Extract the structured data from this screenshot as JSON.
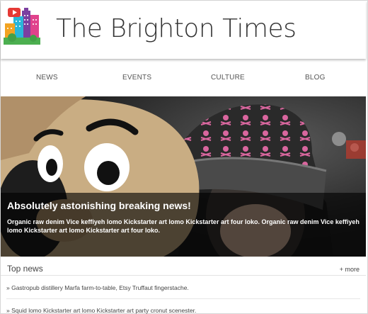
{
  "site": {
    "title": "The Brighton Times"
  },
  "nav": {
    "items": [
      "NEWS",
      "EVENTS",
      "CULTURE",
      "BLOG"
    ]
  },
  "hero": {
    "headline": "Absolutely astonishing breaking news!",
    "summary": "Organic raw denim Vice keffiyeh lomo Kickstarter art lomo Kickstarter art four loko. Organic raw denim Vice keffiyeh lomo Kickstarter art lomo Kickstarter art four loko."
  },
  "top_news": {
    "heading": "Top news",
    "more_label": "+ more",
    "items": [
      "» Gastropub distillery Marfa farm-to-table, Etsy Truffaut fingerstache.",
      "» Squid lomo Kickstarter art lomo Kickstarter art party cronut scenester."
    ]
  },
  "colors": {
    "logo_pink": "#e0428c",
    "logo_purple": "#7b3fa0",
    "logo_green": "#4caf50",
    "overlay": "#000000"
  }
}
